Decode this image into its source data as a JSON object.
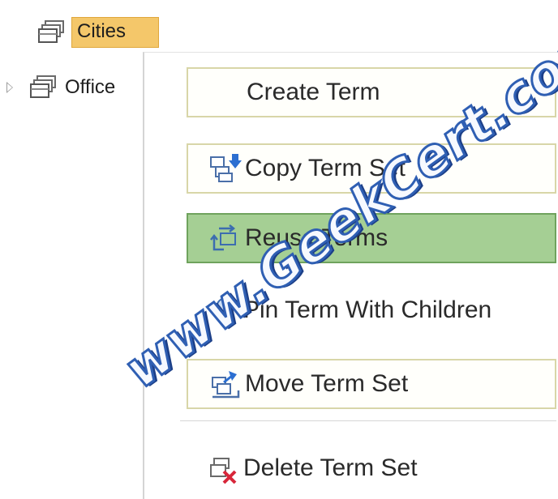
{
  "tree": {
    "items": [
      {
        "label": "Cities",
        "icon": "term-set-icon",
        "selected": true
      },
      {
        "label": "Office",
        "icon": "term-set-icon",
        "selected": false,
        "collapsed": true
      }
    ]
  },
  "context_menu": {
    "items": [
      {
        "label": "Create Term",
        "icon": null,
        "highlighted": false
      },
      {
        "label": "Copy Term Set",
        "icon": "copy-term-set-icon",
        "highlighted": false
      },
      {
        "label": "Reuse Terms",
        "icon": "reuse-terms-icon",
        "highlighted": true
      },
      {
        "label": "Pin Term With Children",
        "icon": "pin-term-icon",
        "highlighted": false
      },
      {
        "label": "Move Term Set",
        "icon": "move-term-set-icon",
        "highlighted": false
      },
      {
        "label": "Delete Term Set",
        "icon": "delete-term-set-icon",
        "highlighted": false
      }
    ]
  },
  "watermark": {
    "text": "www.GeekCert.com"
  },
  "colors": {
    "selection": "#f4c76a",
    "highlight": "#a5cf94",
    "watermark_stroke": "#2f5fb3"
  }
}
